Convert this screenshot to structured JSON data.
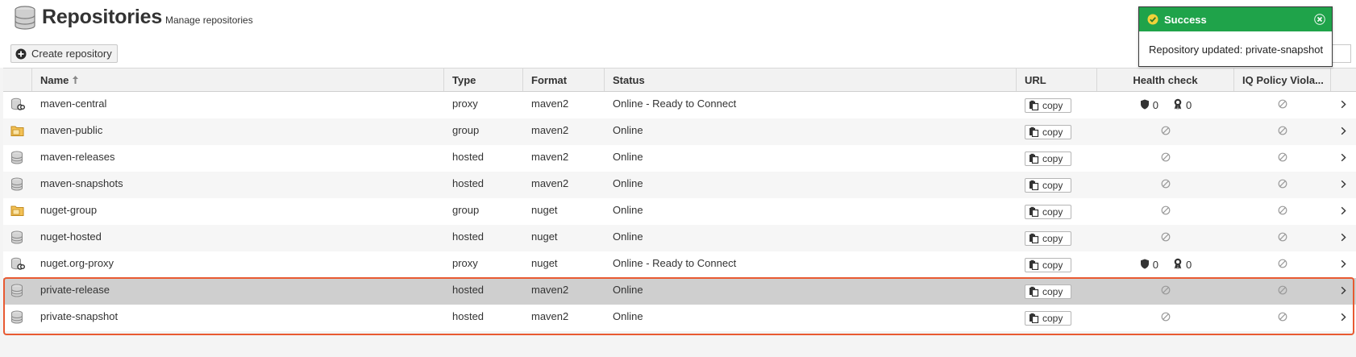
{
  "header": {
    "title": "Repositories",
    "subtitle": "Manage repositories",
    "create_button_label": "Create repository"
  },
  "columns": {
    "name": "Name",
    "type": "Type",
    "format": "Format",
    "status": "Status",
    "url": "URL",
    "health": "Health check",
    "iq": "IQ Policy Viola..."
  },
  "copy_label": "copy",
  "rows": [
    {
      "name": "maven-central",
      "type": "proxy",
      "format": "maven2",
      "status": "Online - Ready to Connect",
      "icon": "proxy-repository-icon",
      "health_security": "0",
      "health_license": "0"
    },
    {
      "name": "maven-public",
      "type": "group",
      "format": "maven2",
      "status": "Online",
      "icon": "group-folder-icon"
    },
    {
      "name": "maven-releases",
      "type": "hosted",
      "format": "maven2",
      "status": "Online",
      "icon": "hosted-database-icon"
    },
    {
      "name": "maven-snapshots",
      "type": "hosted",
      "format": "maven2",
      "status": "Online",
      "icon": "hosted-database-icon"
    },
    {
      "name": "nuget-group",
      "type": "group",
      "format": "nuget",
      "status": "Online",
      "icon": "group-folder-icon"
    },
    {
      "name": "nuget-hosted",
      "type": "hosted",
      "format": "nuget",
      "status": "Online",
      "icon": "hosted-database-icon"
    },
    {
      "name": "nuget.org-proxy",
      "type": "proxy",
      "format": "nuget",
      "status": "Online - Ready to Connect",
      "icon": "proxy-repository-icon",
      "health_security": "0",
      "health_license": "0"
    },
    {
      "name": "private-release",
      "type": "hosted",
      "format": "maven2",
      "status": "Online",
      "icon": "hosted-database-icon"
    },
    {
      "name": "private-snapshot",
      "type": "hosted",
      "format": "maven2",
      "status": "Online",
      "icon": "hosted-database-icon"
    }
  ],
  "toast": {
    "title": "Success",
    "message": "Repository updated: private-snapshot"
  },
  "colors": {
    "toast_header": "#1fa34a",
    "highlight_border": "#e85a32",
    "selected_row": "#cfcfcf"
  }
}
